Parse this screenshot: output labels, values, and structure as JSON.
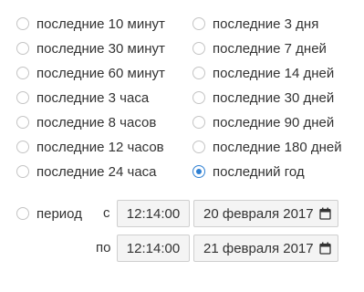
{
  "options_left": [
    {
      "label": "последние 10 минут",
      "selected": false
    },
    {
      "label": "последние 30 минут",
      "selected": false
    },
    {
      "label": "последние 60 минут",
      "selected": false
    },
    {
      "label": "последние 3 часа",
      "selected": false
    },
    {
      "label": "последние 8 часов",
      "selected": false
    },
    {
      "label": "последние 12 часов",
      "selected": false
    },
    {
      "label": "последние 24 часа",
      "selected": false
    }
  ],
  "options_right": [
    {
      "label": "последние 3 дня",
      "selected": false
    },
    {
      "label": "последние 7 дней",
      "selected": false
    },
    {
      "label": "последние 14 дней",
      "selected": false
    },
    {
      "label": "последние 30 дней",
      "selected": false
    },
    {
      "label": "последние 90 дней",
      "selected": false
    },
    {
      "label": "последние 180 дней",
      "selected": false
    },
    {
      "label": "последний год",
      "selected": true
    }
  ],
  "period": {
    "label": "период",
    "selected": false,
    "from_label": "с",
    "to_label": "по",
    "from_time": "12:14:00",
    "from_date": "20 февраля 2017",
    "to_time": "12:14:00",
    "to_date": "21 февраля 2017",
    "calendar_icon": "calendar-icon"
  },
  "colors": {
    "accent": "#2f80d3",
    "radio_border": "#c4c4c4",
    "field_background": "#f4f4f4",
    "text": "#333333"
  }
}
